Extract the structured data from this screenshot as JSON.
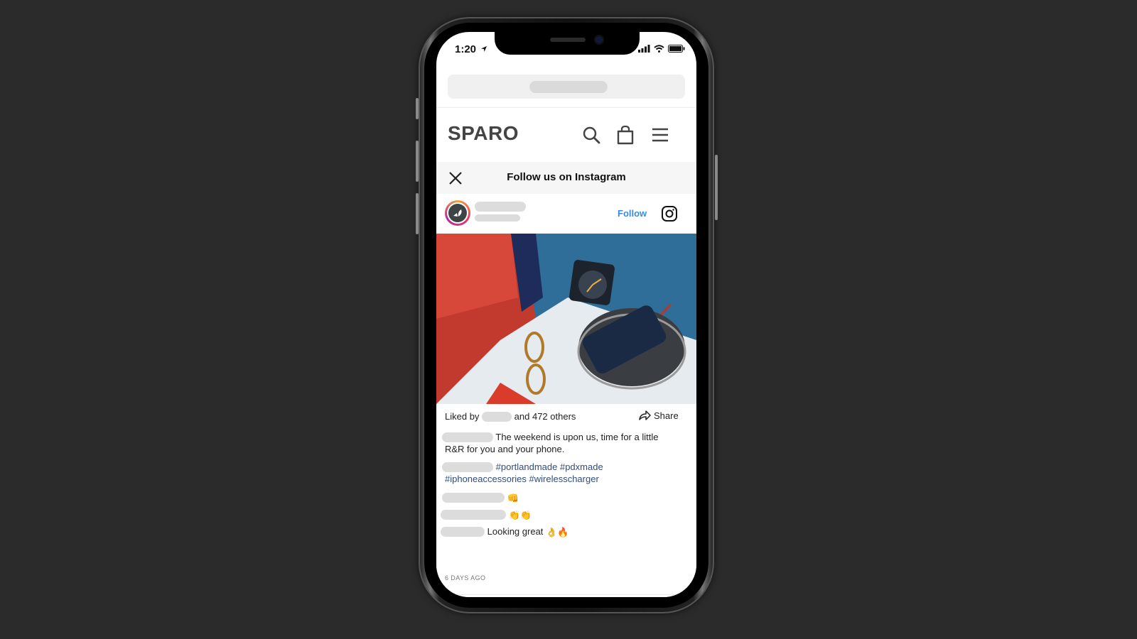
{
  "status_bar": {
    "time": "1:20",
    "location_icon": "location-arrow-icon",
    "signal_icon": "cellular-signal-icon",
    "wifi_icon": "wifi-icon",
    "battery_icon": "battery-icon"
  },
  "browser": {
    "url_placeholder": "redacted-url"
  },
  "site_header": {
    "logo": "SPARO",
    "icons": [
      "search-icon",
      "shopping-bag-icon",
      "menu-icon"
    ]
  },
  "banner": {
    "title": "Follow us on Instagram",
    "close_icon": "close-icon"
  },
  "post": {
    "follow_label": "Follow",
    "instagram_icon": "instagram-icon",
    "image_alt": "Wireless charger with phone on a nightstand beside glasses and alarm clock",
    "likes_prefix": "Liked by",
    "likes_suffix": "and 472 others",
    "share_label": "Share",
    "caption": "The weekend is upon us, time for a little",
    "caption_line2": "R&R for you and your phone.",
    "hashtags_line1": "#portlandmade #pdxmade",
    "hashtags_line2": "#iphoneaccessories #wirelesscharger",
    "comments": [
      {
        "text": "",
        "emoji": "👊"
      },
      {
        "text": "",
        "emoji": "👏👏"
      },
      {
        "text": "Looking great",
        "emoji": "👌🔥"
      }
    ],
    "date": "6 DAYS AGO"
  },
  "colors": {
    "background": "#2b2b2b",
    "follow_blue": "#3b8bd6",
    "hashtag": "#2f4d7f",
    "logo": "#444444"
  }
}
